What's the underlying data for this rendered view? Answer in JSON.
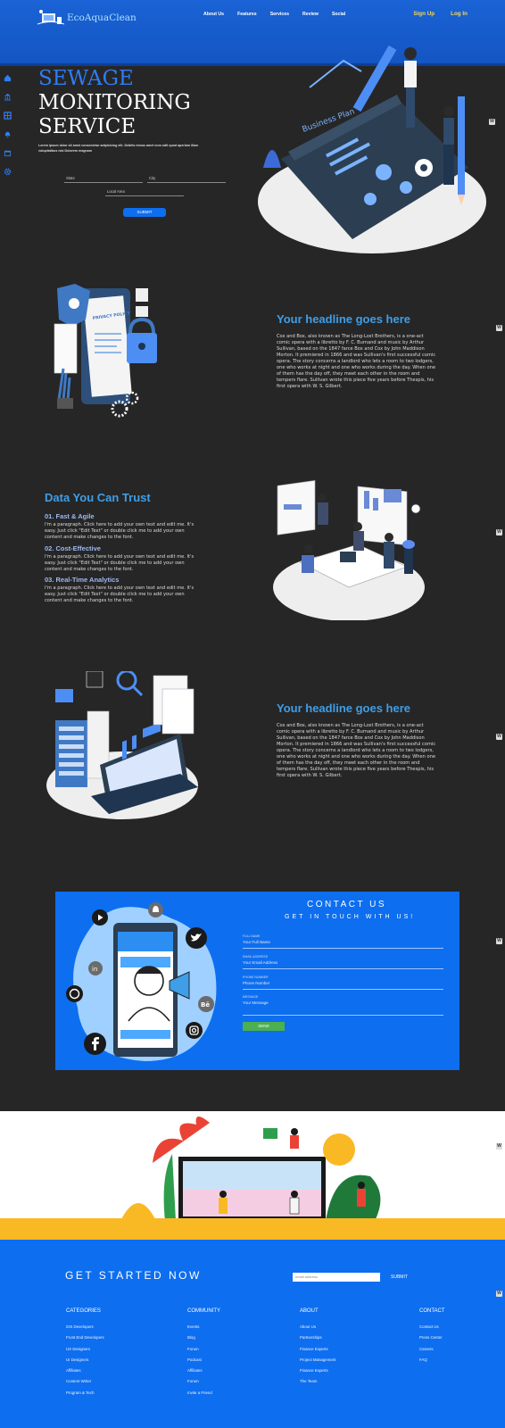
{
  "header": {
    "brand": "EcoAquaClean",
    "nav": [
      "About Us",
      "Features",
      "Services",
      "Review",
      "Social"
    ],
    "sign_up": "Sign Up",
    "log_in": "Log In",
    "colors": {
      "brand_blue": "#1a63d6",
      "accent_yellow": "#ffd84a"
    }
  },
  "side_nav_icons": [
    "home-icon",
    "bank-icon",
    "grid-icon",
    "bell-icon",
    "calendar-icon",
    "gear-icon"
  ],
  "hero": {
    "title_line1": "SEWAGE",
    "title_line2": "MONITORING",
    "title_line3": "SERVICE",
    "description": "Lorem ipsum dolor sit amet consectetur adipisicing elit. Debitis minus amet eum odit quod aperiam illum voluptatibus nisi Dolorem magnam",
    "state_placeholder": "State",
    "city_placeholder": "City",
    "local_area_placeholder": "Local Area",
    "submit_label": "SUBMIT",
    "illustration_text": "Business Plan"
  },
  "section1": {
    "heading": "Your headline goes here",
    "body": "Cox and Box, also known as The Long-Lost Brothers, is a one-act comic opera with a libretto by F. C. Burnand and music by Arthur Sullivan, based on the 1847 farce Box and Cox by John Maddison Morton. It premiered in 1866 and was Sullivan's first successful comic opera. The story concerns a landlord who lets a room to two lodgers, one who works at night and one who works during the day. When one of them has the day off, they meet each other in the room and tempers flare. Sullivan wrote this piece five years before Thespis, his first opera with W. S. Gilbert.",
    "illustration_text": "PRIVACY POLICY"
  },
  "section2": {
    "heading": "Data You Can Trust",
    "items": [
      {
        "title": "01. Fast & Agile",
        "text": "I'm a paragraph. Click here to add your own text and edit me. It's easy. Just click \"Edit Text\" or double click me to add your own content and make changes to the font."
      },
      {
        "title": "02. Cost-Effective",
        "text": "I'm a paragraph. Click here to add your own text and edit me. It's easy. Just click \"Edit Text\" or double click me to add your own content and make changes to the font."
      },
      {
        "title": "03. Real-Time Analytics",
        "text": "I'm a paragraph. Click here to add your own text and edit me. It's easy. Just click \"Edit Text\" or double click me to add your own content and make changes to the font."
      }
    ]
  },
  "section3": {
    "heading": "Your headline goes here",
    "body": "Cox and Box, also known as The Long-Lost Brothers, is a one-act comic opera with a libretto by F. C. Burnand and music by Arthur Sullivan, based on the 1847 farce Box and Cox by John Maddison Morton. It premiered in 1866 and was Sullivan's first successful comic opera. The story concerns a landlord who lets a room to two lodgers, one who works at night and one who works during the day. When one of them has the day off, they meet each other in the room and tempers flare. Sullivan wrote this piece five years before Thespis, his first opera with W. S. Gilbert."
  },
  "contact": {
    "title": "CONTACT US",
    "subtitle": "GET IN TOUCH WITH US!",
    "fields": [
      {
        "label": "FULL NAME",
        "placeholder": "Your Full Name"
      },
      {
        "label": "EMAIL ADDRESS",
        "placeholder": "Your Email Address"
      },
      {
        "label": "PHONE NUMBER",
        "placeholder": "Phone Number"
      },
      {
        "label": "MESSAGE",
        "placeholder": "Your Message"
      }
    ],
    "send_label": "SEND",
    "social_icons": [
      "youtube-icon",
      "notification-icon",
      "twitter-icon",
      "linkedin-icon",
      "whatsapp-icon",
      "behance-icon",
      "facebook-icon",
      "instagram-icon"
    ],
    "colors": {
      "panel": "#0d6ef0",
      "send": "#4caf50"
    }
  },
  "footer": {
    "title": "GET STARTED NOW",
    "email_placeholder": "email address",
    "submit_label": "SUBMIT",
    "columns": [
      {
        "heading": "CATEGORIES",
        "items": [
          "iOS Developers",
          "Front End Developers",
          "UX Designers",
          "UI Designers",
          "Affiliates",
          "Content Writer",
          "Program & Tech"
        ]
      },
      {
        "heading": "COMMUNITY",
        "items": [
          "Events",
          "Blog",
          "Forum",
          "Podcast",
          "Affiliates",
          "Forum",
          "Invite a Friend"
        ]
      },
      {
        "heading": "ABOUT",
        "items": [
          "About Us",
          "Partnerships",
          "Finance Experts",
          "Project Management",
          "Finance Experts",
          "The Team"
        ]
      },
      {
        "heading": "CONTACT",
        "items": [
          "Contact Us",
          "Press Center",
          "Careers",
          "FAQ"
        ]
      }
    ]
  }
}
